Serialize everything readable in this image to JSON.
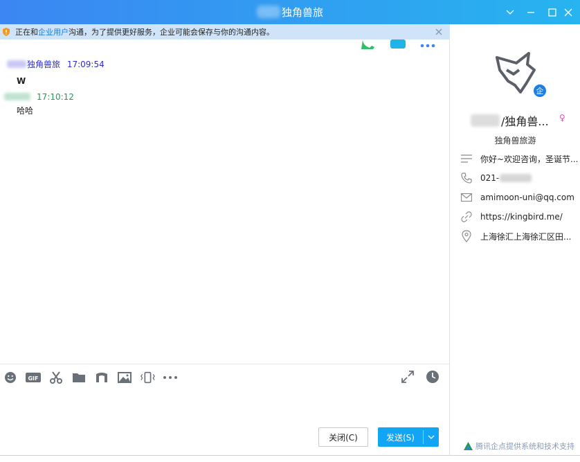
{
  "window": {
    "title": "独角兽旅",
    "accent_color": "#27b4f0"
  },
  "notice": {
    "prefix": "正在和",
    "link": "企业用户",
    "suffix": "沟通，为了提供更好服务，企业可能会保存与你的沟通内容。"
  },
  "messages": [
    {
      "sender": "独角兽旅",
      "time": "17:09:54",
      "body": "W",
      "color": "#2a2ad8"
    },
    {
      "sender": "",
      "time": "17:10:12",
      "body": "哈哈",
      "color": "#1e9b57"
    }
  ],
  "toolbar": {
    "icons": [
      "emoji-icon",
      "gif-icon",
      "scissors-icon",
      "folder-icon",
      "music-icon",
      "image-icon",
      "shake-icon",
      "more-icon"
    ],
    "right_icons": [
      "expand-icon",
      "history-clock-icon"
    ]
  },
  "buttons": {
    "close_label": "关闭(C)",
    "send_label": "发送(S)"
  },
  "profile": {
    "name": "/独角兽...",
    "gender_symbol": "♀",
    "enterprise_badge": "企",
    "company": "独角兽旅游",
    "greeting": "你好~欢迎咨询，圣诞节...",
    "phone_prefix": "021-",
    "email": "amimoon-uni@qq.com",
    "website": "https://kingbird.me/",
    "address": "上海徐汇上海徐汇区田..."
  },
  "footer": {
    "support_text": "腾讯企点提供系统和技术支持"
  }
}
